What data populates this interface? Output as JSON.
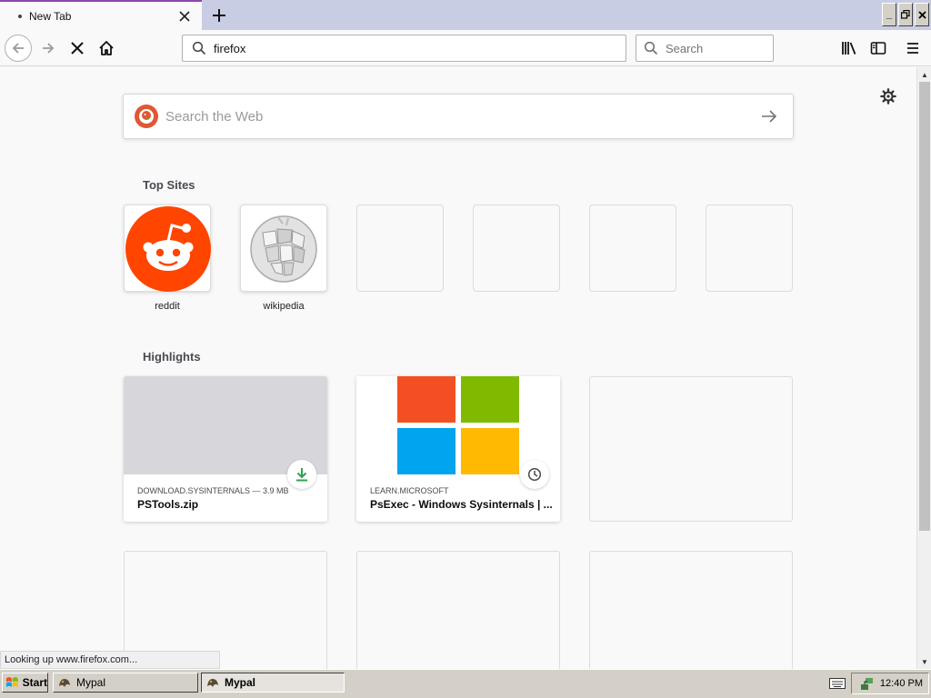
{
  "browser": {
    "tab": {
      "title": "New Tab",
      "close_label": "×"
    },
    "new_tab_label": "+",
    "window_buttons": {
      "minimize": "_",
      "restore": "⧉",
      "close": "✕"
    }
  },
  "navbar": {
    "url_value": "firefox",
    "search_placeholder": "Search"
  },
  "newtab": {
    "web_search_placeholder": "Search the Web",
    "top_sites_title": "Top Sites",
    "top_sites": [
      {
        "label": "reddit",
        "icon": "reddit-icon"
      },
      {
        "label": "wikipedia",
        "icon": "wikipedia-icon"
      },
      {
        "label": ""
      },
      {
        "label": ""
      },
      {
        "label": ""
      },
      {
        "label": ""
      }
    ],
    "highlights_title": "Highlights",
    "highlights": [
      {
        "meta": "DOWNLOAD.SYSINTERNALS — 3.9 MB",
        "title": "PSTools.zip",
        "badge": "download-icon"
      },
      {
        "meta": "LEARN.MICROSOFT",
        "title": "PsExec - Windows Sysinternals | ...",
        "badge": "clock-icon"
      }
    ]
  },
  "status_text": "Looking up www.firefox.com...",
  "taskbar": {
    "start_label": "Start",
    "items": [
      "Mypal",
      "Mypal"
    ],
    "clock": "12:40 PM"
  },
  "colors": {
    "reddit": "#ff4500",
    "tab_accent": "#8e44ad",
    "ms_red": "#f25022",
    "ms_green": "#7fba00",
    "ms_blue": "#00a4ef",
    "ms_yellow": "#ffb900",
    "download_green": "#30a14e"
  }
}
